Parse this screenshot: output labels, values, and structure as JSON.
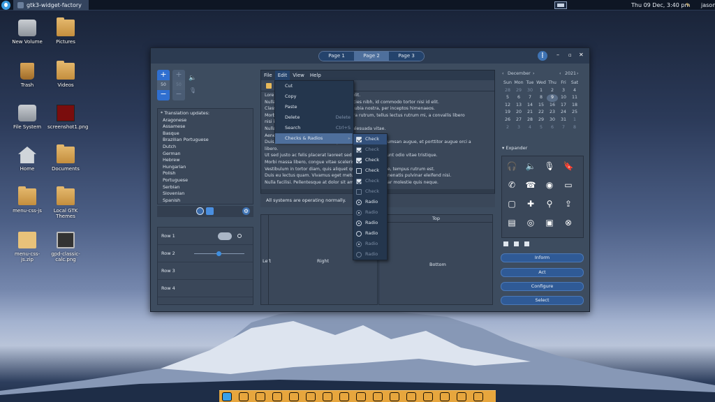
{
  "panel": {
    "task_title": "gtk3-widget-factory",
    "clock": "Thu 09 Dec,  3:40 pm",
    "user": "jason"
  },
  "desktop": [
    {
      "label": "New Volume",
      "icon": "drive-icon"
    },
    {
      "label": "Pictures",
      "icon": "folder-icon"
    },
    {
      "label": "Trash",
      "icon": "trash-icon"
    },
    {
      "label": "Videos",
      "icon": "folder-icon"
    },
    {
      "label": "File System",
      "icon": "drive-icon"
    },
    {
      "label": "screenshot1.png",
      "icon": "image-icon"
    },
    {
      "label": "Home",
      "icon": "home-icon"
    },
    {
      "label": "Documents",
      "icon": "folder-icon"
    },
    {
      "label": "menu-css-js",
      "icon": "folder-icon"
    },
    {
      "label": "Local GTK Themes",
      "icon": "folder-icon"
    },
    {
      "label": "menu-css-js.zip",
      "icon": "archive-icon"
    },
    {
      "label": "gpd-classic-calc.png",
      "icon": "calculator-icon"
    }
  ],
  "window": {
    "tabs": [
      "Page 1",
      "Page 2",
      "Page 3"
    ],
    "active_tab": "Page 2",
    "spin_value_1": "50",
    "spin_value_2": "50",
    "languages_header": "* Translation updates:",
    "languages": [
      "Aragonese",
      "Assamese",
      "Basque",
      "Brazilian Portuguese",
      "Dutch",
      "German",
      "Hebrew",
      "Hungarian",
      "Polish",
      "Portuguese",
      "Serbian",
      "Slovenian",
      "Spanish"
    ],
    "rows": [
      "Row 1",
      "Row 2",
      "Row 3",
      "Row 4"
    ],
    "menubar": [
      "File",
      "Edit",
      "View",
      "Help"
    ],
    "edit_menu": [
      {
        "label": "Cut",
        "accel": ""
      },
      {
        "label": "Copy",
        "accel": ""
      },
      {
        "label": "Paste",
        "accel": ""
      },
      {
        "label": "Delete",
        "accel": "Delete"
      },
      {
        "label": "Search",
        "accel": "Ctrl+S"
      },
      {
        "label": "Checks & Radios",
        "accel": "▸"
      }
    ],
    "checks_menu": [
      {
        "label": "Check",
        "type": "check",
        "on": true,
        "disabled": false
      },
      {
        "label": "Check",
        "type": "check",
        "on": true,
        "disabled": true
      },
      {
        "label": "Check",
        "type": "check",
        "on": true,
        "disabled": false
      },
      {
        "label": "Check",
        "type": "check",
        "on": false,
        "disabled": false
      },
      {
        "label": "Check",
        "type": "check",
        "on": true,
        "disabled": true
      },
      {
        "label": "Check",
        "type": "check",
        "on": false,
        "disabled": true
      },
      {
        "label": "Radio",
        "type": "radio",
        "on": true,
        "disabled": false
      },
      {
        "label": "Radio",
        "type": "radio",
        "on": true,
        "disabled": true
      },
      {
        "label": "Radio",
        "type": "radio",
        "on": true,
        "disabled": false
      },
      {
        "label": "Radio",
        "type": "radio",
        "on": false,
        "disabled": false
      },
      {
        "label": "Radio",
        "type": "radio",
        "on": true,
        "disabled": true
      },
      {
        "label": "Radio",
        "type": "radio",
        "on": false,
        "disabled": true
      }
    ],
    "text_lines": [
      "Lore                                          dipiscing elit.",
      "Nulla                                         lacus ultricies nibh, id commodo tortor nisi id elit.",
      "Class                                         nt per conubia nostra, per inceptos himenaeos.",
      "Morb                                          et pharetra rutrum, tellus lectus rutrum mi, a convallis libero",
      "nisi i",
      "Nulla                                                     malesuada vitae.",
      "Aene                                                      n arcu.",
      "Duis elementum, tellus sed tristique semp                 accumsan augue, et porttitor augue orci a",
      "libero.",
      "Ut sed justo ac felis placerat laoreet sed id             tincidunt odio vitae tristique.",
      "Morbi massa libero, congue vitae scelerisq                nisl.",
      "Vestibulum in tortor diam, quis aliquet qu                neque, tempus rutrum est.",
      "Duis eu lectus quam. Vivamus eget metus                   venenatis pulvinar eleifend nisi.",
      "Nulla facilisi. Pellentesque at dolor sit ame             pulvinar molestie quis neque."
    ],
    "status": "All systems are operating normally.",
    "pane_labels": {
      "left": "Left",
      "right": "Right",
      "top": "Top",
      "bottom": "Bottom"
    },
    "calendar": {
      "month": "December",
      "year": "2021",
      "weekdays": [
        "Sun",
        "Mon",
        "Tue",
        "Wed",
        "Thu",
        "Fri",
        "Sat"
      ],
      "days": [
        [
          "28",
          "d"
        ],
        [
          "29",
          "d"
        ],
        [
          "30",
          "d"
        ],
        [
          "1",
          ""
        ],
        [
          "2",
          ""
        ],
        [
          "3",
          ""
        ],
        [
          "4",
          ""
        ],
        [
          "5",
          ""
        ],
        [
          "6",
          ""
        ],
        [
          "7",
          ""
        ],
        [
          "8",
          ""
        ],
        [
          "9",
          "s"
        ],
        [
          "10",
          ""
        ],
        [
          "11",
          ""
        ],
        [
          "12",
          ""
        ],
        [
          "13",
          ""
        ],
        [
          "14",
          ""
        ],
        [
          "15",
          ""
        ],
        [
          "16",
          ""
        ],
        [
          "17",
          ""
        ],
        [
          "18",
          ""
        ],
        [
          "19",
          ""
        ],
        [
          "20",
          ""
        ],
        [
          "21",
          ""
        ],
        [
          "22",
          ""
        ],
        [
          "23",
          ""
        ],
        [
          "24",
          ""
        ],
        [
          "25",
          ""
        ],
        [
          "26",
          ""
        ],
        [
          "27",
          ""
        ],
        [
          "28",
          ""
        ],
        [
          "29",
          ""
        ],
        [
          "30",
          ""
        ],
        [
          "31",
          ""
        ],
        [
          "1",
          "d"
        ],
        [
          "2",
          "d"
        ],
        [
          "3",
          "d"
        ],
        [
          "4",
          "d"
        ],
        [
          "5",
          "d"
        ],
        [
          "6",
          "d"
        ],
        [
          "7",
          "d"
        ],
        [
          "8",
          "d"
        ]
      ]
    },
    "expander": "Expander",
    "icons": [
      "headphones-icon",
      "volume-icon",
      "microphone-icon",
      "bookmark-icon",
      "phone-icon",
      "hangup-icon",
      "camera-icon",
      "video-icon",
      "video-outline-icon",
      "plus-icon",
      "network-icon",
      "upload-icon",
      "drive-icon",
      "optical-icon",
      "storage-icon",
      "cancel-icon"
    ],
    "buttons": [
      "Inform",
      "Act",
      "Configure",
      "Select"
    ]
  }
}
